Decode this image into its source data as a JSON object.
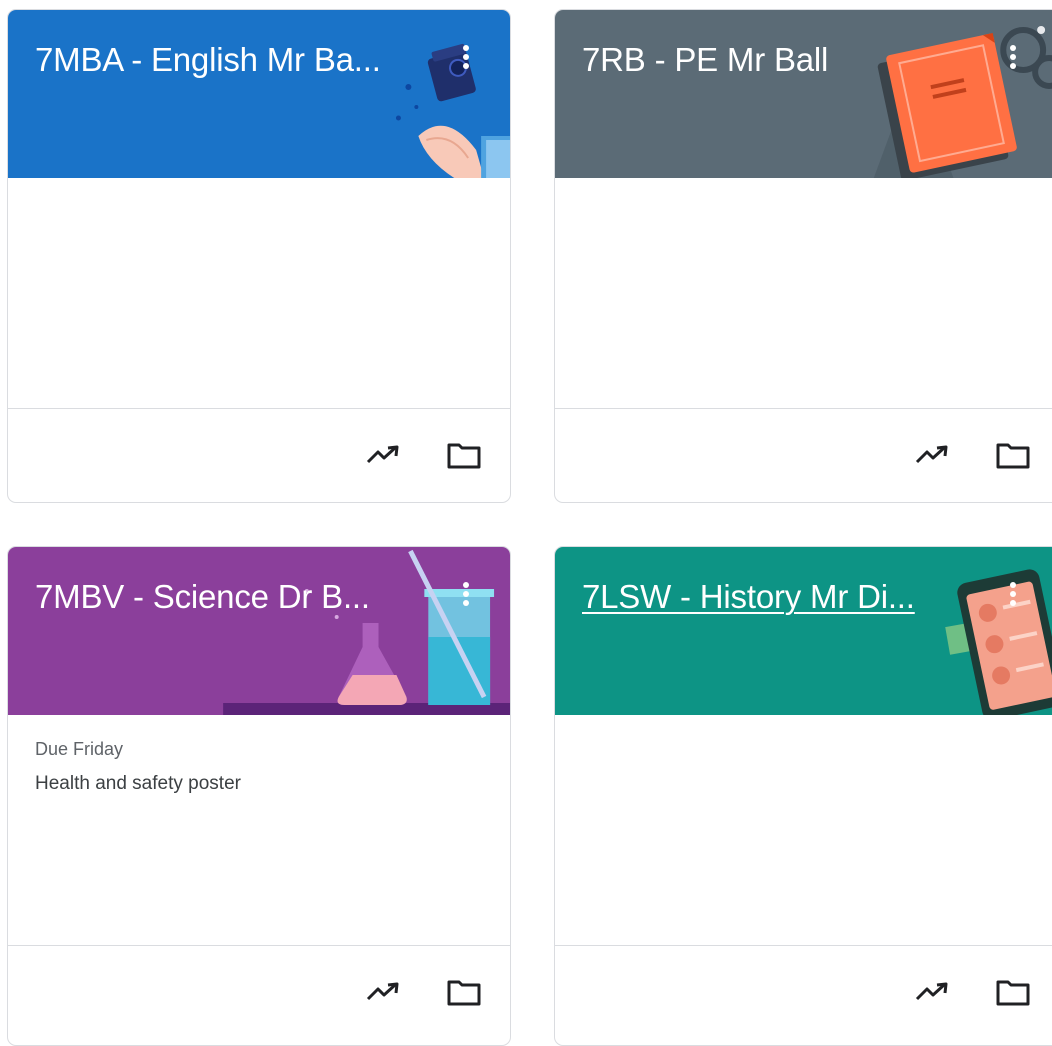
{
  "classes": [
    {
      "title": "7MBA - English Mr Ba...",
      "header_color": "#1a73c8",
      "underlined": false,
      "due_label": "",
      "due_item": "",
      "icons": {
        "more": "more-vert-icon",
        "stats": "trending-up-icon",
        "folder": "folder-icon"
      }
    },
    {
      "title": "7RB - PE Mr Ball",
      "header_color": "#5b6b76",
      "underlined": false,
      "due_label": "",
      "due_item": "",
      "icons": {
        "more": "more-vert-icon",
        "stats": "trending-up-icon",
        "folder": "folder-icon"
      }
    },
    {
      "title": "7MBV - Science Dr B...",
      "header_color": "#8b3f9b",
      "underlined": false,
      "due_label": "Due Friday",
      "due_item": "Health and safety poster",
      "icons": {
        "more": "more-vert-icon",
        "stats": "trending-up-icon",
        "folder": "folder-icon"
      }
    },
    {
      "title": "7LSW - History Mr Di...",
      "header_color": "#0d9485",
      "underlined": true,
      "due_label": "",
      "due_item": "",
      "icons": {
        "more": "more-vert-icon",
        "stats": "trending-up-icon",
        "folder": "folder-icon"
      }
    }
  ]
}
